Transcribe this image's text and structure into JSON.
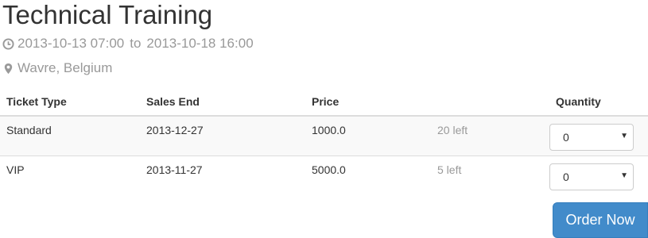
{
  "event": {
    "title": "Technical Training",
    "start": "2013-10-13 07:00",
    "separator": "to",
    "end": "2013-10-18 16:00",
    "location": "Wavre, Belgium",
    "date_icon": "clock-icon",
    "location_icon": "map-marker-icon"
  },
  "table": {
    "headers": {
      "type": "Ticket Type",
      "sales_end": "Sales End",
      "price": "Price",
      "availability": "",
      "quantity": "Quantity"
    },
    "rows": [
      {
        "type": "Standard",
        "sales_end": "2013-12-27",
        "price": "1000.0",
        "left": "20 left",
        "quantity": "0"
      },
      {
        "type": "VIP",
        "sales_end": "2013-11-27",
        "price": "5000.0",
        "left": "5 left",
        "quantity": "0"
      }
    ]
  },
  "order_button": {
    "label": "Order Now",
    "color": "#428bca"
  }
}
